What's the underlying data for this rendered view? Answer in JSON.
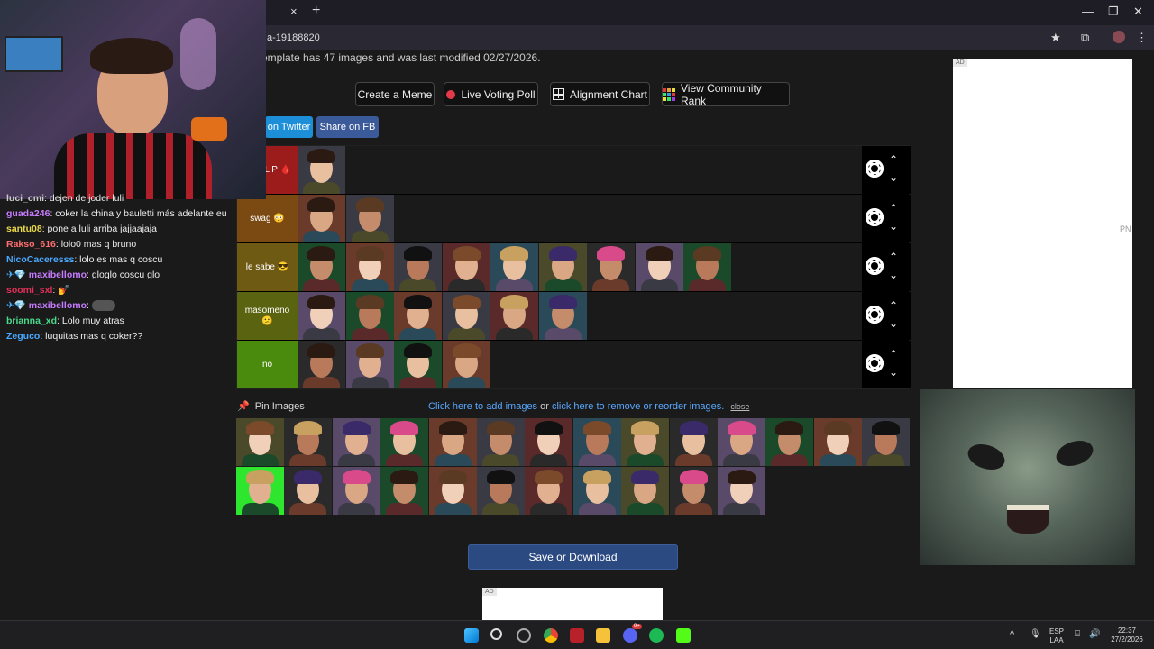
{
  "browser": {
    "tab_close": "×",
    "new_tab": "+",
    "url": "a-19188820",
    "win_min": "—",
    "win_max": "❐",
    "win_close": "✕",
    "star_icon": "star-icon",
    "ext_icon": "extensions-icon",
    "menu_icon": "kebab-menu-icon"
  },
  "page": {
    "note": "emplate has 47 images and was last modified 02/27/2026.",
    "buttons": {
      "create_meme": "Create a Meme",
      "live_poll": "Live Voting Poll",
      "alignment": "Alignment Chart",
      "community_rank": "View Community Rank"
    },
    "share_twitter": "on Twitter",
    "share_fb": "Share on FB",
    "tiers": [
      {
        "label": "S DEL\nP 🩸",
        "color": "#9c1c1c",
        "count": 1
      },
      {
        "label": "swag 😳",
        "color": "#7a4a12",
        "count": 2
      },
      {
        "label": "le sabe 😎",
        "color": "#6e5a12",
        "count": 9
      },
      {
        "label": "masomeno 😕",
        "color": "#5a6410",
        "count": 6
      },
      {
        "label": "no",
        "color": "#4a8a0c",
        "count": 4
      }
    ],
    "pin_label": "Pin Images",
    "add_link": "Click here to add images",
    "or_text": " or ",
    "reorder_link": "click here to remove or reorder images.",
    "close_link": "close",
    "pool_row1_count": 14,
    "pool_row2_count": 11,
    "save_button": "Save or Download",
    "ad_label": "AD",
    "side_ad_text": "PN"
  },
  "chat": [
    {
      "user": "luci_cmi",
      "color": "#cccccc",
      "msg": ": dejen de joder luli"
    },
    {
      "user": "guada246",
      "color": "#c87cff",
      "msg": ": coker la china y bauletti más adelante eu"
    },
    {
      "user": "santu08",
      "color": "#e8d84a",
      "msg": ": pone a luli arriba jajjaajaja"
    },
    {
      "user": "Rakso_616",
      "color": "#ff6e6e",
      "msg": ": lolo0 mas q bruno"
    },
    {
      "user": "NicoCaceresss",
      "color": "#4aa8ff",
      "msg": ": lolo es mas q coscu"
    },
    {
      "user": "maxibellomo",
      "color": "#c87cff",
      "msg": ": gloglo coscu glo",
      "badges": "✈💎"
    },
    {
      "user": "soomi_sxl",
      "color": "#e0305a",
      "msg": ": 💅"
    },
    {
      "user": "maxibellomo",
      "color": "#c87cff",
      "msg": ": ",
      "badges": "✈💎"
    },
    {
      "user": "brianna_xd",
      "color": "#4adb8a",
      "msg": ": Lolo muy atras"
    },
    {
      "user": "Zeguco",
      "color": "#4aa8ff",
      "msg": ": luquitas mas q coker??"
    }
  ],
  "taskbar": {
    "lang_top": "ESP",
    "lang_bottom": "LAA",
    "time": "22:37",
    "date": "27/2/2026",
    "tray_up": "^",
    "discord_badge": "9+"
  }
}
